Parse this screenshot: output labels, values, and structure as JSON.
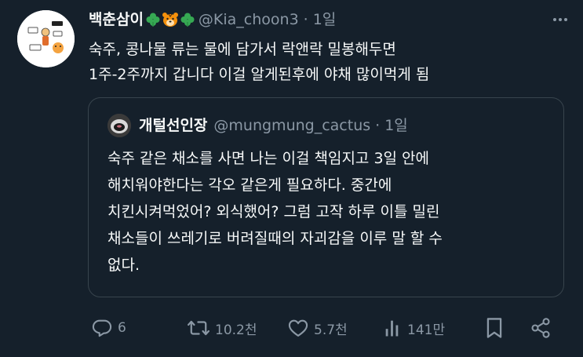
{
  "tweet": {
    "display_name": "백춘삼이",
    "name_emojis": [
      "clover-emoji",
      "tiger-emoji",
      "clover-emoji"
    ],
    "handle": "@Kia_choon3",
    "separator": "·",
    "time": "1일",
    "lines": [
      "숙주, 콩나물 류는 물에 담가서 락앤락 밀봉해두면",
      "1주-2주까지 갑니다 이걸 알게된후에 야채 많이먹게 됨"
    ]
  },
  "quote": {
    "display_name": "개털선인장",
    "handle": "@mungmung_cactus",
    "separator": "·",
    "time": "1일",
    "lines": [
      "숙주 같은 채소를 사면 나는 이걸 책임지고 3일 안에",
      "해치워야한다는 각오 같은게 필요하다. 중간에",
      "치킨시켜먹었어? 외식했어? 그럼 고작 하루 이틀 밀린",
      "채소들이 쓰레기로 버려질때의 자괴감을 이루 말 할 수",
      "없다."
    ]
  },
  "actions": {
    "replies": "6",
    "retweets": "10.2천",
    "likes": "5.7천",
    "views": "141만"
  },
  "colors": {
    "background": "#15202b",
    "text": "#f7f9f9",
    "muted": "#8b98a5",
    "border": "#38444d",
    "clover": "#36a853",
    "tiger": "#f4900c"
  },
  "icons": [
    "more-icon",
    "reply-icon",
    "retweet-icon",
    "like-icon",
    "views-icon",
    "bookmark-icon",
    "share-icon"
  ]
}
